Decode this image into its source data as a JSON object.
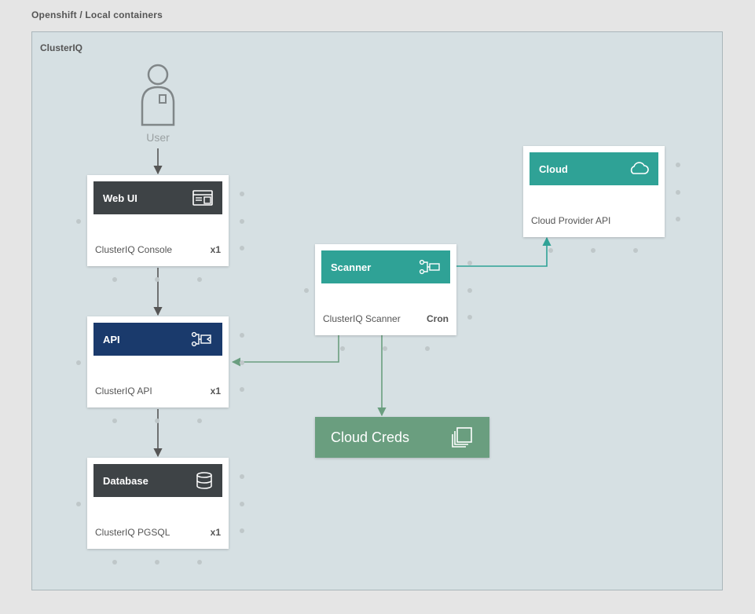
{
  "breadcrumb": "Openshift / Local containers",
  "frame_title": "ClusterIQ",
  "actor": {
    "label": "User"
  },
  "nodes": {
    "webui": {
      "title": "Web UI",
      "subtitle": "ClusterIQ Console",
      "tag": "x1"
    },
    "api": {
      "title": "API",
      "subtitle": "ClusterIQ API",
      "tag": "x1"
    },
    "db": {
      "title": "Database",
      "subtitle": "ClusterIQ PGSQL",
      "tag": "x1"
    },
    "scan": {
      "title": "Scanner",
      "subtitle": "ClusterIQ Scanner",
      "tag": "Cron"
    },
    "cloud": {
      "title": "Cloud",
      "subtitle": "Cloud Provider API",
      "tag": ""
    }
  },
  "slab": {
    "title": "Cloud Creds"
  },
  "edges": [
    {
      "from": "user",
      "to": "webui",
      "kind": "vert"
    },
    {
      "from": "webui",
      "to": "api",
      "kind": "vert"
    },
    {
      "from": "api",
      "to": "db",
      "kind": "vert"
    },
    {
      "from": "scan",
      "to": "api",
      "kind": "elbow"
    },
    {
      "from": "scan",
      "to": "cloud",
      "kind": "elbow"
    },
    {
      "from": "scan",
      "to": "creds",
      "kind": "vert"
    }
  ],
  "colors": {
    "gray": "#3e4346",
    "blue": "#1a3a6c",
    "teal": "#2fa296",
    "green": "#6a9e7f",
    "canvas": "#d6e0e3",
    "stroke": "#555555"
  }
}
